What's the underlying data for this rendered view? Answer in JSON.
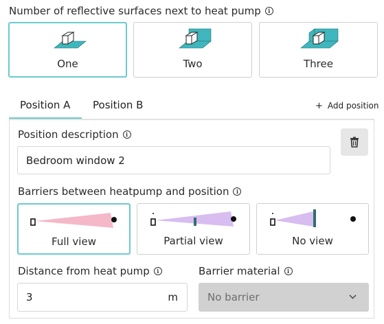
{
  "surfaces": {
    "heading": "Number of reflective surfaces next to heat pump",
    "options": [
      {
        "label": "One",
        "selected": true
      },
      {
        "label": "Two",
        "selected": false
      },
      {
        "label": "Three",
        "selected": false
      }
    ]
  },
  "tabs": [
    {
      "label": "Position A",
      "active": true
    },
    {
      "label": "Position B",
      "active": false
    }
  ],
  "add_position": {
    "icon": "plus-icon",
    "label": "Add position"
  },
  "position": {
    "description_label": "Position description",
    "description_value": "Bedroom window 2",
    "delete_icon": "trash-icon",
    "barriers_label": "Barriers between heatpump and position",
    "barrier_options": [
      {
        "label": "Full view",
        "selected": true
      },
      {
        "label": "Partial view",
        "selected": false
      },
      {
        "label": "No view",
        "selected": false
      }
    ],
    "distance_label": "Distance from heat pump",
    "distance_value": "3",
    "distance_unit": "m",
    "material_label": "Barrier material",
    "material_value": "No barrier"
  },
  "colors": {
    "accent": "#6cc9cf",
    "surface_teal": "#3fb6bd",
    "full_view_cone": "#f4b8c8",
    "partial_view_cone": "#d8bdf0",
    "barrier_post": "#2f6f6f"
  }
}
